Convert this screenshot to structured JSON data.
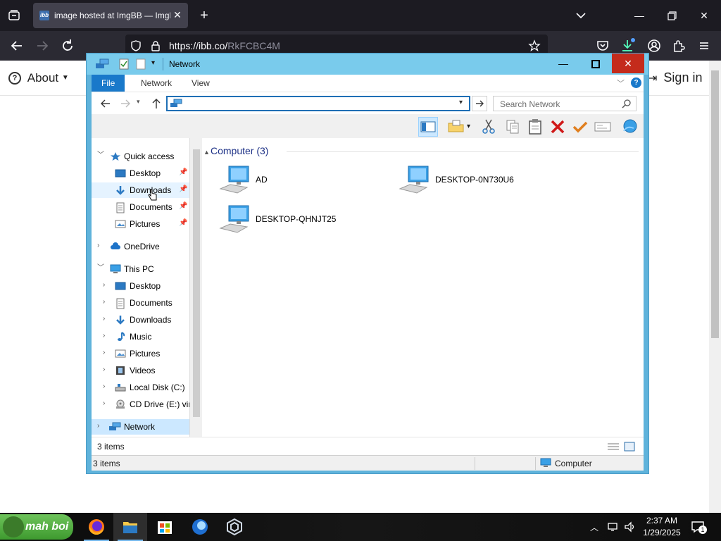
{
  "browser": {
    "tab_title": "image hosted at ImgBB — ImgBB",
    "url_host": "https://ibb.co/",
    "url_rest": "RkFCBC4M"
  },
  "page": {
    "about_label": "About",
    "signin_label": "Sign in"
  },
  "explorer": {
    "title": "Network",
    "ribbon_tabs": [
      "File",
      "Network",
      "View"
    ],
    "search_placeholder": "Search Network",
    "nav": {
      "quick_access": "Quick access",
      "qa_items": [
        "Desktop",
        "Downloads",
        "Documents",
        "Pictures"
      ],
      "onedrive": "OneDrive",
      "this_pc": "This PC",
      "pc_items": [
        "Desktop",
        "Documents",
        "Downloads",
        "Music",
        "Pictures",
        "Videos",
        "Local Disk (C:)",
        "CD Drive (E:) virt"
      ],
      "network": "Network"
    },
    "group_header": "Computer (3)",
    "computers": [
      "AD",
      "DESKTOP-0N730U6",
      "DESKTOP-QHNJT25"
    ],
    "status_count": "3 items",
    "status_count_lower": "3 items",
    "status_location": "Computer"
  },
  "taskbar": {
    "start_label": "mah boi",
    "time": "2:37 AM",
    "date": "1/29/2025",
    "notification_count": "1"
  }
}
